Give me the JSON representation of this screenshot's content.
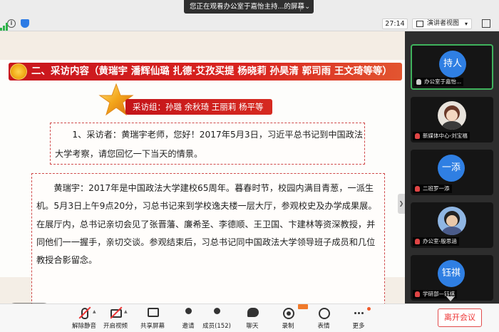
{
  "window": {
    "share_banner": "您正在观看办公室于嘉怡主持...的屏幕"
  },
  "statusbar": {
    "timer": "27:14",
    "view_mode": "演讲者视图"
  },
  "slide": {
    "title": "二、采访内容（黄瑞宇 潘辉仙璐 扎德·艾孜买提 杨晓莉 孙昊清 郭司雨 王文琦等等）",
    "group_label": "采访组：孙璐 余秋琦 王丽莉 杨平等",
    "question": "1、采访者：黄瑞宇老师，您好！2017年5月3日，习近平总书记到中国政法大学考察，请您回忆一下当天的情景。",
    "answer": "黄瑞宇：2017年是中国政法大学建校65周年。暮春时节，校园内满目青葱，一派生机。5月3日上午9点20分，习总书记来到学校逸夫楼一层大厅，参观校史及办学成果展。在展厅内，总书记亲切会见了张晋藩、廉希圣、李德顺、王卫国、卞建林等资深教授，并同他们一一握手，亲切交谈。参观结束后，习总书记同中国政法大学领导班子成员和几位教授合影留念。"
  },
  "participants": [
    {
      "avatar_text": "持人",
      "name": "办公室于嘉怡..."
    },
    {
      "avatar_text": "",
      "name": "新媒体中心-刘宝福"
    },
    {
      "avatar_text": "一添",
      "name": "二班罗一添"
    },
    {
      "avatar_text": "",
      "name": "办公室-殷思涵"
    },
    {
      "avatar_text": "钰祺",
      "name": "学研部—钰祺"
    }
  ],
  "toolbar": {
    "mute": "解除静音",
    "video": "开启视频",
    "share": "共享屏幕",
    "invite": "邀请",
    "members": "成员(152)",
    "chat": "聊天",
    "record": "录制",
    "emoji": "表情",
    "more": "更多",
    "leave": "离开会议"
  },
  "colors": {
    "title_red": "#d21b1f",
    "avatar_blue": "#2f7fe3",
    "active_green": "#3fb25c",
    "leave_red": "#e33333"
  }
}
